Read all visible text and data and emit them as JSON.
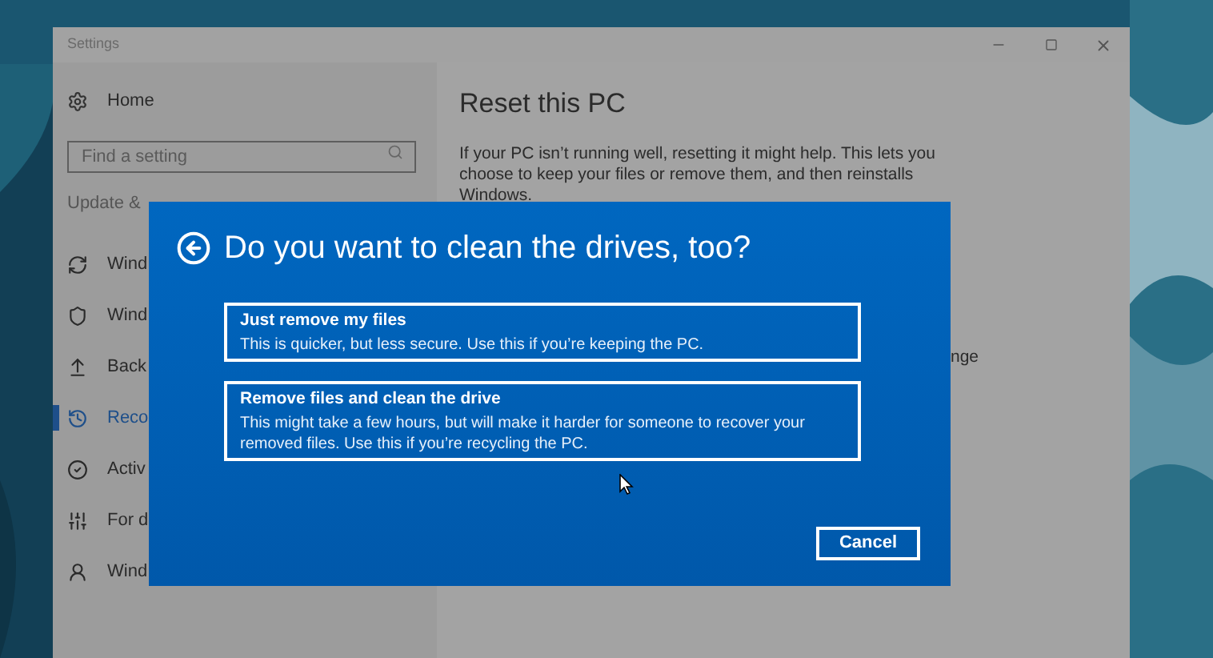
{
  "window": {
    "title": "Settings"
  },
  "sidebar": {
    "home": "Home",
    "search": {
      "placeholder": "Find a setting"
    },
    "section": "Update &",
    "items": [
      {
        "label": "Wind",
        "selected": false
      },
      {
        "label": "Wind",
        "selected": false
      },
      {
        "label": "Back",
        "selected": false
      },
      {
        "label": "Reco",
        "selected": true
      },
      {
        "label": "Activ",
        "selected": false
      },
      {
        "label": "For d",
        "selected": false
      },
      {
        "label": "Wind",
        "selected": false
      }
    ]
  },
  "content": {
    "title": "Reset this PC",
    "description": "If your PC isn’t running well, resetting it might help. This lets you choose to keep your files or remove them, and then reinstalls Windows.",
    "fragment": "nge"
  },
  "dialog": {
    "title": "Do you want to clean the drives, too?",
    "options": [
      {
        "title": "Just remove my files",
        "description": "This is quicker, but less secure. Use this if you’re keeping the PC."
      },
      {
        "title": "Remove files and clean the drive",
        "description": "This might take a few hours, but will make it harder for someone to recover your removed files. Use this if you’re recycling the PC."
      }
    ],
    "cancel": "Cancel"
  }
}
